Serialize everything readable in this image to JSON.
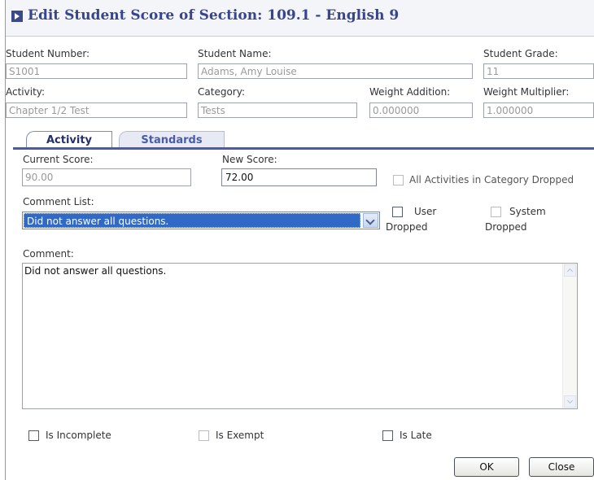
{
  "dialog": {
    "title": "Edit Student Score of Section: 109.1 - English 9"
  },
  "student": {
    "number_label": "Student Number:",
    "number_value": "S1001",
    "name_label": "Student Name:",
    "name_value": "Adams, Amy Louise",
    "grade_label": "Student Grade:",
    "grade_value": "11"
  },
  "activity_info": {
    "activity_label": "Activity:",
    "activity_value": "Chapter 1/2 Test",
    "category_label": "Category:",
    "category_value": "Tests",
    "weight_add_label": "Weight Addition:",
    "weight_add_value": "0.000000",
    "weight_mult_label": "Weight Multiplier:",
    "weight_mult_value": "1.000000"
  },
  "tabs": [
    {
      "label": "Activity",
      "active": true
    },
    {
      "label": "Standards",
      "active": false
    }
  ],
  "scores": {
    "current_label": "Current Score:",
    "current_value": "90.00",
    "new_label": "New Score:",
    "new_value": "72.00"
  },
  "checkboxes": {
    "all_dropped": "All Activities in Category Dropped",
    "user_dropped_line1": "User",
    "user_dropped_line2": "Dropped",
    "system_dropped_line1": "System",
    "system_dropped_line2": "Dropped",
    "incomplete": "Is Incomplete",
    "exempt": "Is Exempt",
    "late": "Is Late"
  },
  "comment_list": {
    "label": "Comment List:",
    "selected": "Did not answer all questions."
  },
  "comment": {
    "label": "Comment:",
    "value": "Did not answer all questions."
  },
  "buttons": {
    "ok": "OK",
    "close": "Close"
  },
  "colors": {
    "title": "#37448e",
    "tab_accent": "#4a5ca8",
    "selection": "#3169c6"
  }
}
